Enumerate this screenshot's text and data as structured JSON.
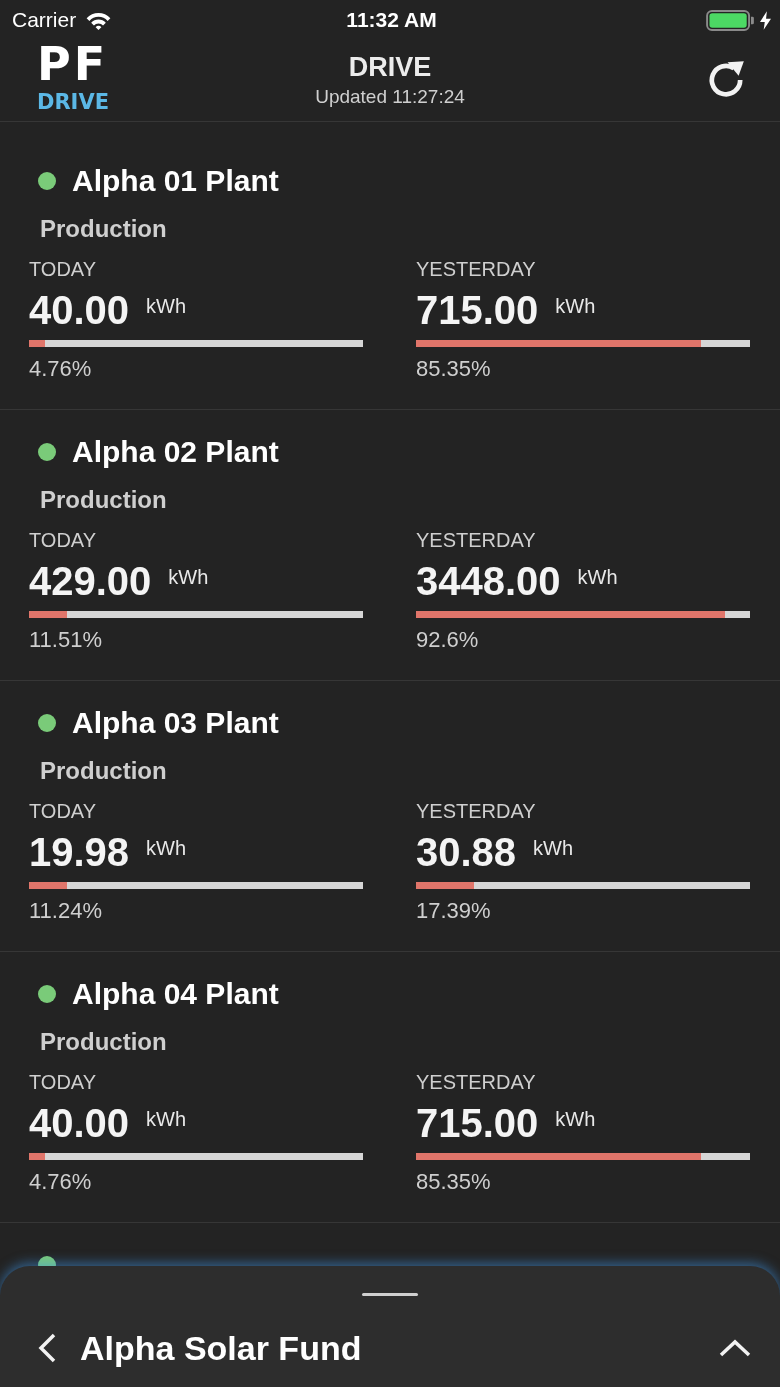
{
  "status_bar": {
    "carrier": "Carrier",
    "time": "11:32 AM"
  },
  "header": {
    "logo": {
      "top": "PF",
      "bottom": "DRIVE"
    },
    "title": "DRIVE",
    "subtitle": "Updated 11:27:24"
  },
  "plants": [
    {
      "name": "Alpha 01 Plant",
      "color": "#7acb79",
      "section": "Production",
      "metrics": [
        {
          "label": "TODAY",
          "value": "40.00",
          "unit": "kWh",
          "level": 0.0476,
          "percent": "4.76%"
        },
        {
          "label": "YESTERDAY",
          "value": "715.00",
          "unit": "kWh",
          "level": 0.8535,
          "percent": "85.35%"
        }
      ]
    },
    {
      "name": "Alpha 02 Plant",
      "color": "#7acb79",
      "section": "Production",
      "metrics": [
        {
          "label": "TODAY",
          "value": "429.00",
          "unit": "kWh",
          "level": 0.1151,
          "percent": "11.51%"
        },
        {
          "label": "YESTERDAY",
          "value": "3448.00",
          "unit": "kWh",
          "level": 0.926,
          "percent": "92.6%"
        }
      ]
    },
    {
      "name": "Alpha 03 Plant",
      "color": "#7acb79",
      "section": "Production",
      "metrics": [
        {
          "label": "TODAY",
          "value": "19.98",
          "unit": "kWh",
          "level": 0.1124,
          "percent": "11.24%"
        },
        {
          "label": "YESTERDAY",
          "value": "30.88",
          "unit": "kWh",
          "level": 0.1739,
          "percent": "17.39%"
        }
      ]
    },
    {
      "name": "Alpha 04 Plant",
      "color": "#7acb79",
      "section": "Production",
      "metrics": [
        {
          "label": "TODAY",
          "value": "40.00",
          "unit": "kWh",
          "level": 0.0476,
          "percent": "4.76%"
        },
        {
          "label": "YESTERDAY",
          "value": "715.00",
          "unit": "kWh",
          "level": 0.8535,
          "percent": "85.35%"
        }
      ]
    },
    {
      "color": "#7acb79"
    }
  ],
  "bottom_sheet": {
    "title": "Alpha Solar Fund"
  }
}
